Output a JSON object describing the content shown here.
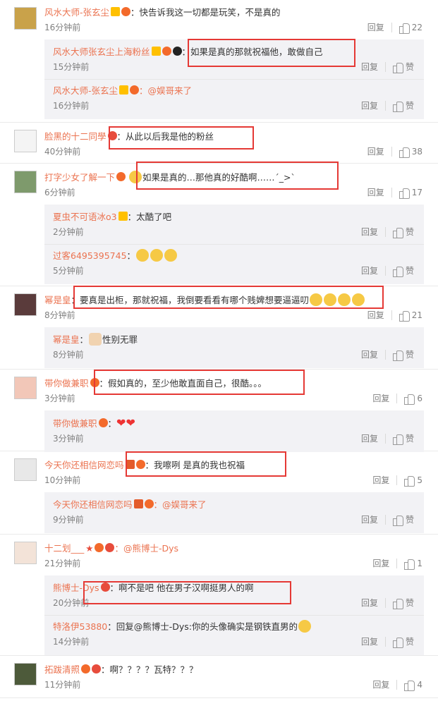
{
  "comments": [
    {
      "user": "风水大师-张玄尘",
      "text": "：快告诉我这一切都是玩笑，不是真的",
      "time": "16分钟前",
      "reply": "回复",
      "likes": "22",
      "replies": [
        {
          "user": "风水大师张玄尘上海粉丝",
          "text": "：如果是真的那就祝福他，敢做自己",
          "time": "15分钟前",
          "reply": "回复",
          "likes": "赞"
        },
        {
          "user": "风水大师-张玄尘",
          "text": "：@娱哥来了",
          "time": "16分钟前",
          "reply": "回复",
          "likes": "赞"
        }
      ]
    },
    {
      "user": "脸黑的十二同學",
      "text": "：从此以后我是他的粉丝",
      "time": "40分钟前",
      "reply": "回复",
      "likes": "38"
    },
    {
      "user": "打字少女了解一下",
      "text": "如果是真的…那他真的好酷啊……´_>`",
      "time": "6分钟前",
      "reply": "回复",
      "likes": "17",
      "replies": [
        {
          "user": "夏虫不可语冰o3",
          "text": "：太酷了吧",
          "time": "2分钟前",
          "reply": "回复",
          "likes": "赞"
        },
        {
          "user": "过客6495395745",
          "text": "：",
          "time": "5分钟前",
          "reply": "回复",
          "likes": "赞"
        }
      ]
    },
    {
      "user": "幂是皇",
      "text": "：要真是出柜，那就祝福，我倒要看看有哪个贱婢想要逼逼叨",
      "time": "8分钟前",
      "reply": "回复",
      "likes": "21",
      "replies": [
        {
          "user": "幂是皇",
          "text": "：性别无罪",
          "time": "8分钟前",
          "reply": "回复",
          "likes": "赞"
        }
      ]
    },
    {
      "user": "带你做兼职",
      "text": "：假如真的，至少他敢直面自己，很酷。。。",
      "time": "3分钟前",
      "reply": "回复",
      "likes": "6",
      "replies": [
        {
          "user": "带你做兼职",
          "text": "：",
          "time": "3分钟前",
          "reply": "回复",
          "likes": "赞"
        }
      ]
    },
    {
      "user": "今天你还相信网恋吗",
      "text": "：我嚓咧 是真的我也祝福",
      "time": "10分钟前",
      "reply": "回复",
      "likes": "5",
      "replies": [
        {
          "user": "今天你还相信网恋吗",
          "text": "：@娱哥来了",
          "time": "9分钟前",
          "reply": "回复",
          "likes": "赞"
        }
      ]
    },
    {
      "user": "十二划___",
      "text": "：@熊博士-Dys",
      "time": "21分钟前",
      "reply": "回复",
      "likes": "1",
      "replies": [
        {
          "user": "熊博士-Dys",
          "text": "：啊不是吧 他在男子汉啊挺男人的啊",
          "time": "20分钟前",
          "reply": "回复",
          "likes": "赞"
        },
        {
          "user": "特洛伊53880",
          "text": "：回复@熊博士-Dys:你的头像确实是钢铁直男的",
          "time": "14分钟前",
          "reply": "回复",
          "likes": "赞"
        }
      ]
    },
    {
      "user": "拓跋清照",
      "text": "：啊？？？？瓦特？？？",
      "time": "11分钟前",
      "reply": "回复",
      "likes": "4"
    }
  ],
  "colors": {
    "name": "#eb7350",
    "highlight": "#e53935",
    "subBg": "#f2f2f5"
  }
}
